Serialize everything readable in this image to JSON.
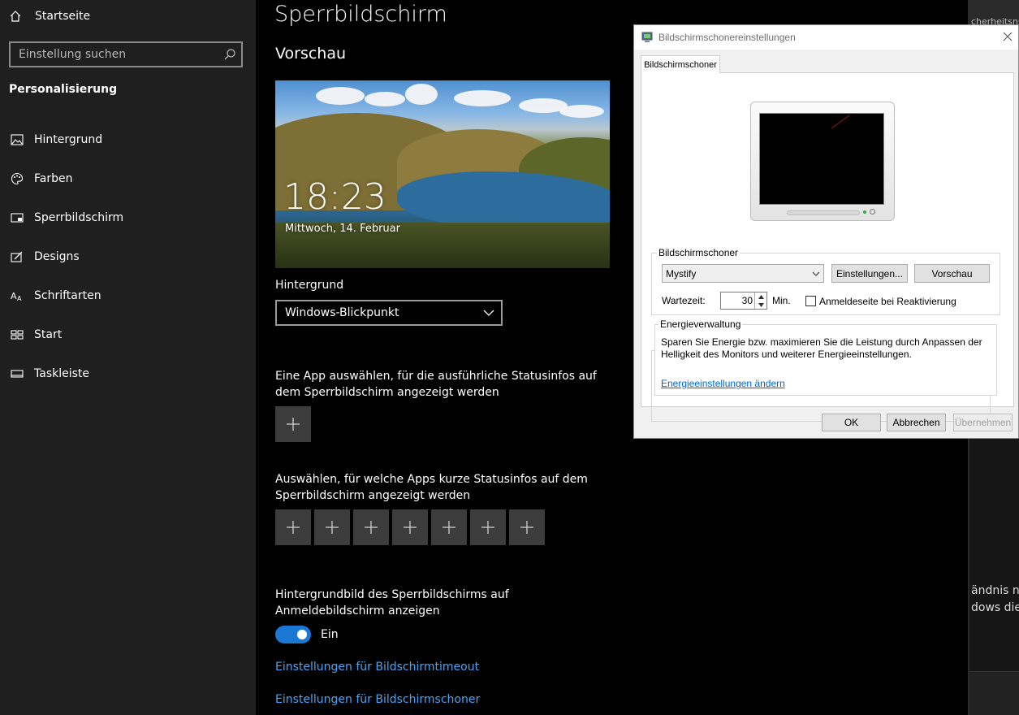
{
  "sidebar": {
    "home_label": "Startseite",
    "search_placeholder": "Einstellung suchen",
    "section_title": "Personalisierung",
    "items": [
      {
        "label": "Hintergrund"
      },
      {
        "label": "Farben"
      },
      {
        "label": "Sperrbildschirm"
      },
      {
        "label": "Designs"
      },
      {
        "label": "Schriftarten"
      },
      {
        "label": "Start"
      },
      {
        "label": "Taskleiste"
      }
    ]
  },
  "main": {
    "title": "Sperrbildschirm",
    "preview_heading": "Vorschau",
    "preview_time": "18:23",
    "preview_date": "Mittwoch, 14. Februar",
    "background_label": "Hintergrund",
    "background_value": "Windows-Blickpunkt",
    "detailed_status_text": "Eine App auswählen, für die ausführliche Statusinfos auf dem Sperrbildschirm angezeigt werden",
    "quick_status_text": "Auswählen, für welche Apps kurze Statusinfos auf dem Sperrbildschirm angezeigt werden",
    "signin_bg_text": "Hintergrundbild des Sperrbildschirms auf Anmeldebildschirm anzeigen",
    "toggle_state": "Ein",
    "toggle_on": true,
    "link_timeout": "Einstellungen für Bildschirmtimeout",
    "link_screensaver": "Einstellungen für Bildschirmschoner",
    "accent_color": "#1a78d4",
    "link_color": "#4aa3f0"
  },
  "right_strip": {
    "fragment_top": "cherheitsnutzun",
    "fragment_1": "ändnis na",
    "fragment_2": "dows die"
  },
  "dialog": {
    "title": "Bildschirmschonereinstellungen",
    "tab_label": "Bildschirmschoner",
    "group_screensaver_title": "Bildschirmschoner",
    "screensaver_value": "Mystify",
    "settings_button": "Einstellungen...",
    "preview_button": "Vorschau",
    "wait_label": "Wartezeit:",
    "wait_value": "30",
    "wait_unit": "Min.",
    "resume_checkbox_label": "Anmeldeseite bei Reaktivierung",
    "resume_checked": false,
    "group_power_title": "Energieverwaltung",
    "power_text": "Sparen Sie Energie bzw. maximieren Sie die Leistung durch Anpassen der Helligkeit des Monitors und weiterer Energieeinstellungen.",
    "power_link": "Energieeinstellungen ändern",
    "ok_button": "OK",
    "cancel_button": "Abbrechen",
    "apply_button": "Übernehmen"
  }
}
